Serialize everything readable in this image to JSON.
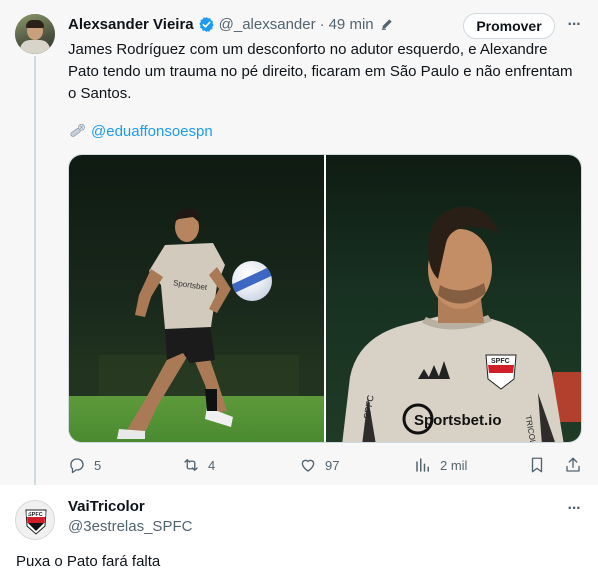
{
  "tweet": {
    "author_name": "Alexsander Vieira",
    "handle": "@_alexsander",
    "separator": "·",
    "time": "49 min",
    "promote_label": "Promover",
    "more_label": "···",
    "text": "James Rodríguez com um desconforto no adutor esquerdo, e Alexandre Pato tendo um trauma no pé direito, ficaram em São Paulo e não enfrentam o Santos.",
    "mention": "@eduaffonsoespn",
    "photo1_shirt_text": "Sportsbet",
    "photo2_badge_text": "SPFC",
    "photo2_sponsor_text": "Sportsbet.io",
    "photo2_sleeve_text": "SPFC",
    "photo2_sleeve_right_text": "TRICOLOR",
    "stats": {
      "replies": "5",
      "reposts": "4",
      "likes": "97",
      "views": "2 mil"
    }
  },
  "reply": {
    "author_name": "VaiTricolor",
    "handle": "@3estrelas_SPFC",
    "avatar_badge_text": "SPFC",
    "more_label": "···",
    "text": "Puxa o Pato fará falta"
  },
  "colors": {
    "accent": "#1d9bf0",
    "muted": "#536471",
    "spfc_red": "#d11f2a"
  }
}
